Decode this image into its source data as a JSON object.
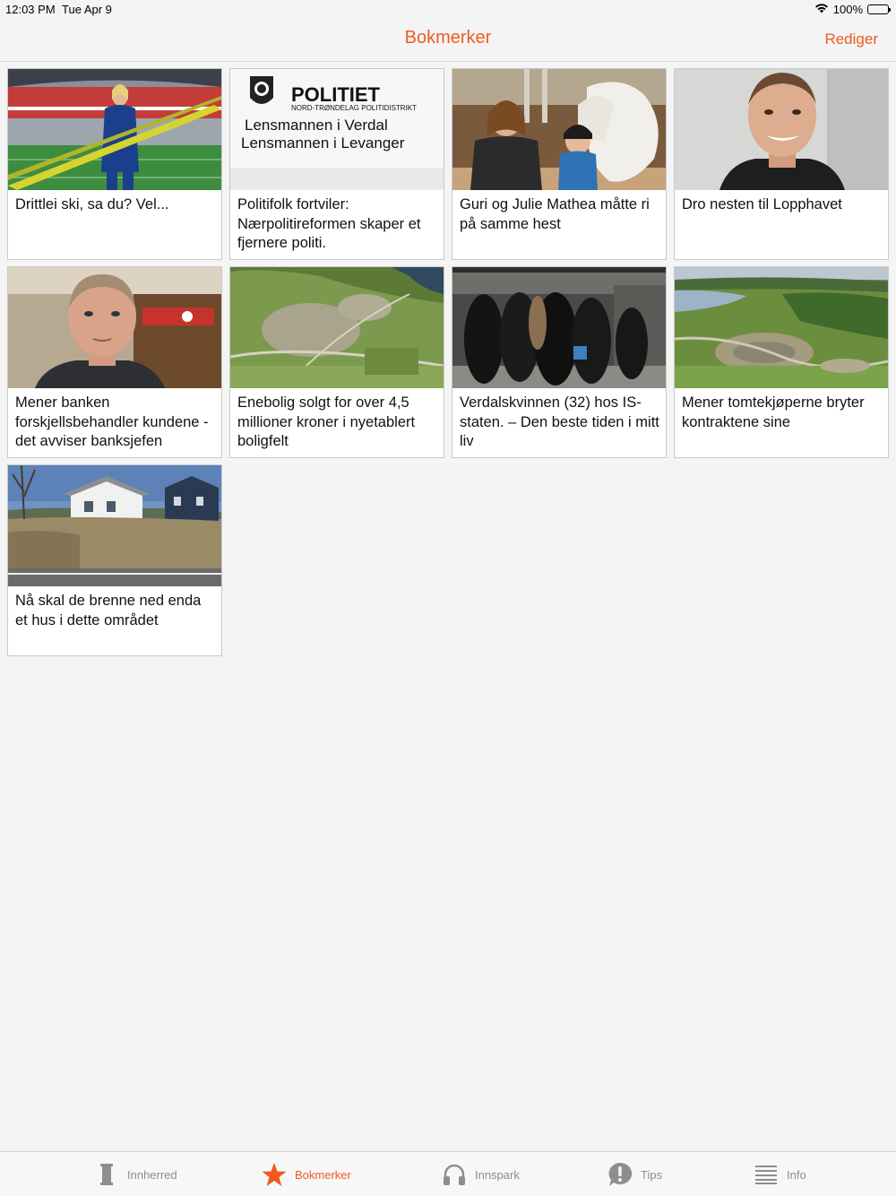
{
  "status": {
    "time": "12:03 PM",
    "date": "Tue Apr 9",
    "battery": "100%"
  },
  "nav": {
    "title": "Bokmerker",
    "edit_label": "Rediger"
  },
  "articles": [
    {
      "title": "Drittlei ski, sa du? Vel..."
    },
    {
      "title": "Politifolk fortviler: Nærpolitireformen skaper et fjernere politi.",
      "image_text": {
        "line1": "POLITIET",
        "line2": "NORD-TRØNDELAG POLITIDISTRIKT",
        "line3": "Lensmannen i Verdal",
        "line4": "Lensmannen i Levanger"
      }
    },
    {
      "title": "Guri og Julie Mathea måtte ri på samme hest"
    },
    {
      "title": "Dro nesten til Lopphavet"
    },
    {
      "title": "Mener banken forskjellsbehandler kundene - det avviser banksjefen"
    },
    {
      "title": "Enebolig solgt for over 4,5 millioner kroner i nyetablert boligfelt"
    },
    {
      "title": "Verdalskvinnen (32) hos IS-staten. – Den beste tiden i mitt liv"
    },
    {
      "title": "Mener tomtekjøperne bryter kontraktene sine"
    },
    {
      "title": "Nå skal de brenne ned enda et hus i dette området"
    }
  ],
  "tabs": [
    {
      "label": "Innherred",
      "icon": "innherred-logo-icon",
      "active": false
    },
    {
      "label": "Bokmerker",
      "icon": "star-icon",
      "active": true
    },
    {
      "label": "Innspark",
      "icon": "headphones-icon",
      "active": false
    },
    {
      "label": "Tips",
      "icon": "exclamation-bubble-icon",
      "active": false
    },
    {
      "label": "Info",
      "icon": "list-icon",
      "active": false
    }
  ],
  "colors": {
    "accent": "#f05a1e",
    "inactive": "#8e8e8e",
    "background": "#f4f4f4"
  }
}
